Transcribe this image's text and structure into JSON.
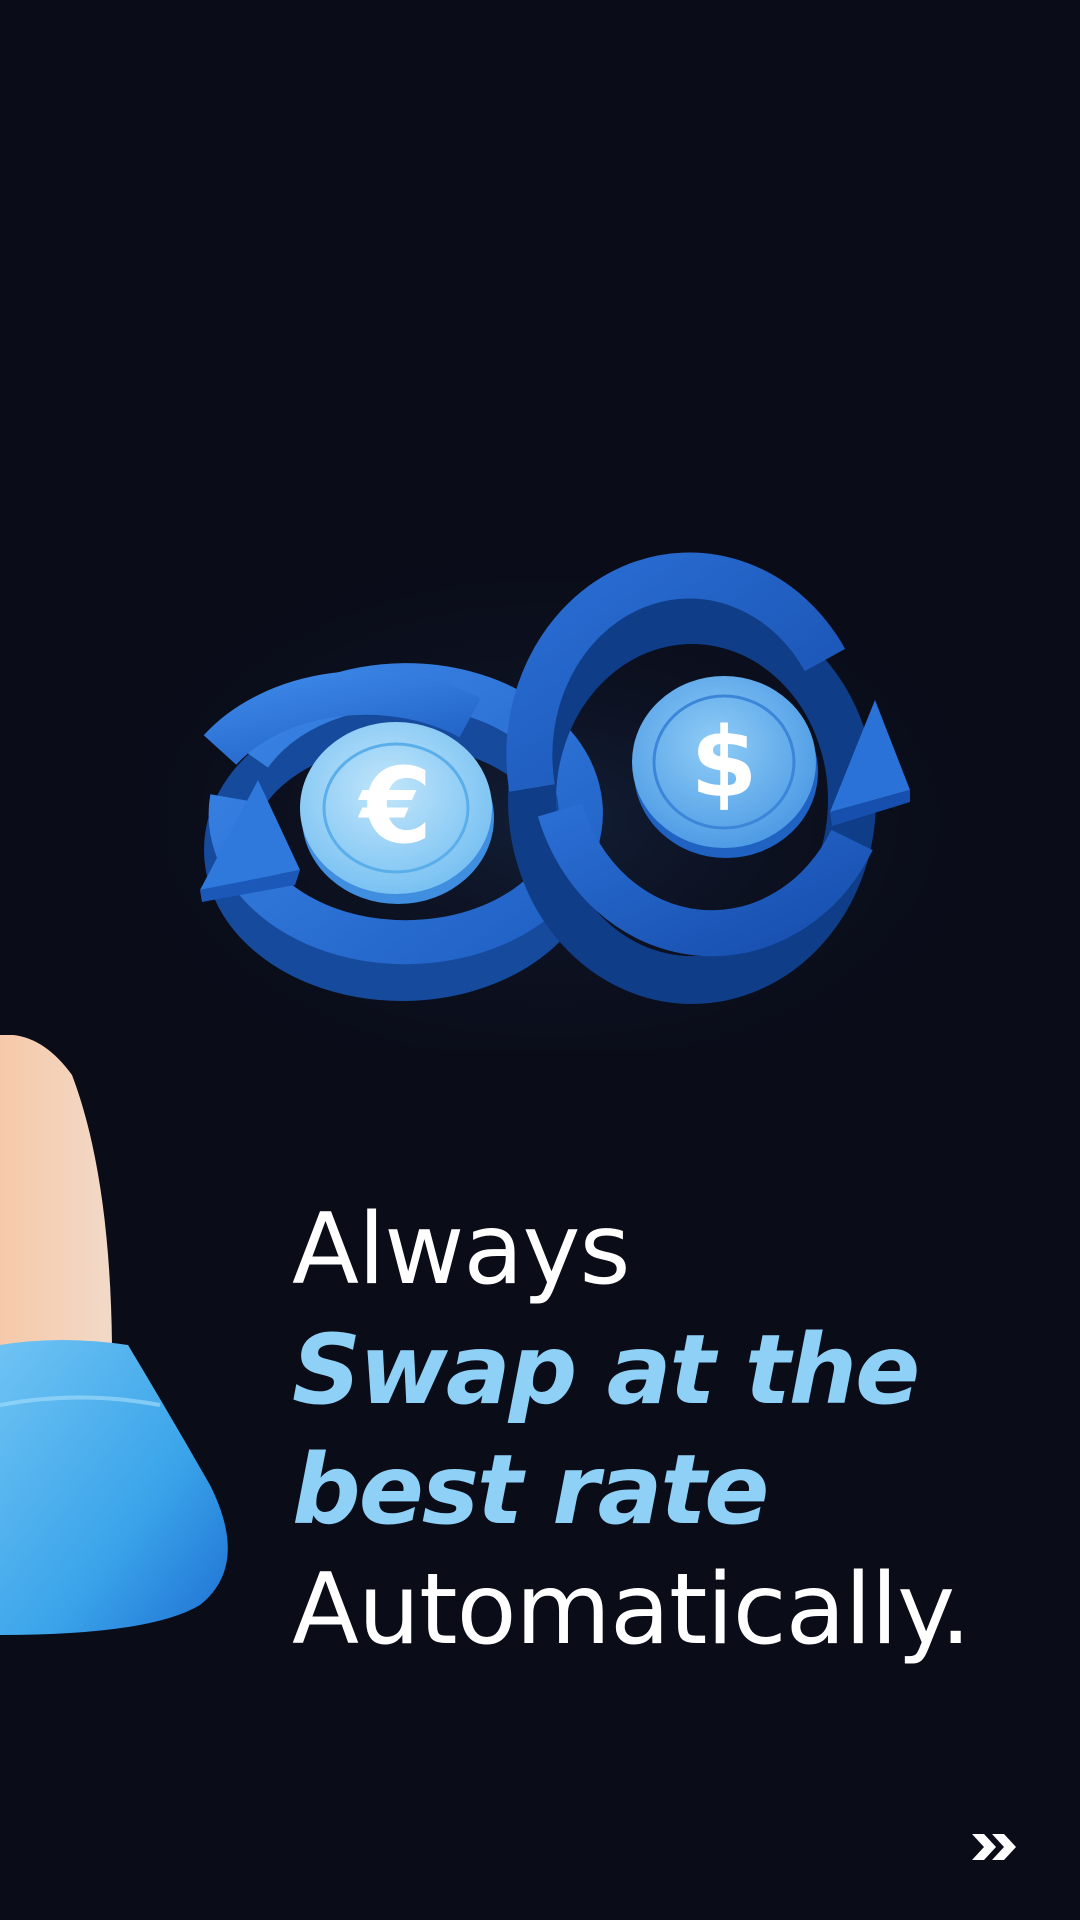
{
  "headline": {
    "line1": "Always",
    "line2": "Swap at the",
    "line3": "best rate",
    "line4": "Automatically."
  },
  "hero": {
    "left_coin_symbol": "€",
    "right_coin_symbol": "$",
    "icon": "currency-exchange-icon"
  },
  "navigation": {
    "next_icon": "double-chevron-right-icon"
  },
  "colors": {
    "background": "#0a0c18",
    "accent": "#8fd0f6",
    "arrow_blue": "#2a6fd6",
    "coin_light": "#9fd6f8"
  }
}
